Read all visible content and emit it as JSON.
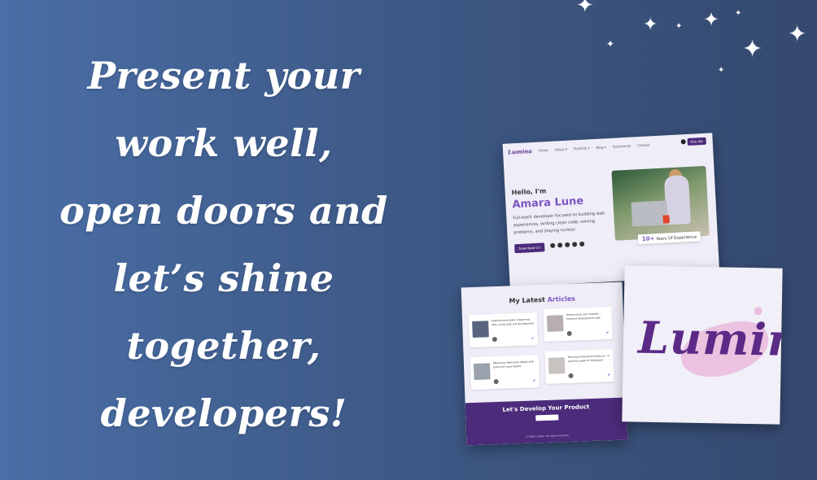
{
  "headline": {
    "lines": [
      "Present your",
      "work well,",
      "open doors and",
      "let’s shine",
      "together,",
      "developers!"
    ]
  },
  "hero_card": {
    "logo": "Lumina",
    "nav": [
      "Home",
      "About ▾",
      "Portfolio ▾",
      "Blog ▾",
      "Testimonial",
      "Contact"
    ],
    "hire_button": "Hire Me",
    "greeting": "Hello, I'm",
    "name": "Amara Lune",
    "bio": "Full-stack developer focused on building web experiences, writing clean code, solving problems, and staying curious",
    "download_button": "Download CV",
    "experience_number": "10+",
    "experience_label": "Years Of Experience"
  },
  "articles_card": {
    "title_prefix": "My Latest",
    "title_highlight": "Articles",
    "articles": [
      "Essential principles: responsive, APIs, using tools and development",
      "Writing clean and scalable frontend development code",
      "Mastering responsive design with grids and visual assets",
      "Planning frontend architecture - A practical guide for beginners"
    ],
    "footer_title": "Let's Develop Your Product",
    "footer_copy": "© 2024 Lumina. All rights reserved"
  },
  "logo_card": {
    "logo_text": "Lumina"
  },
  "colors": {
    "background_left": "#4a6ea6",
    "background_right": "#35496f",
    "brand_purple": "#4b2b7a",
    "accent_purple": "#7d56c4",
    "splash_pink": "#e8b4da"
  }
}
